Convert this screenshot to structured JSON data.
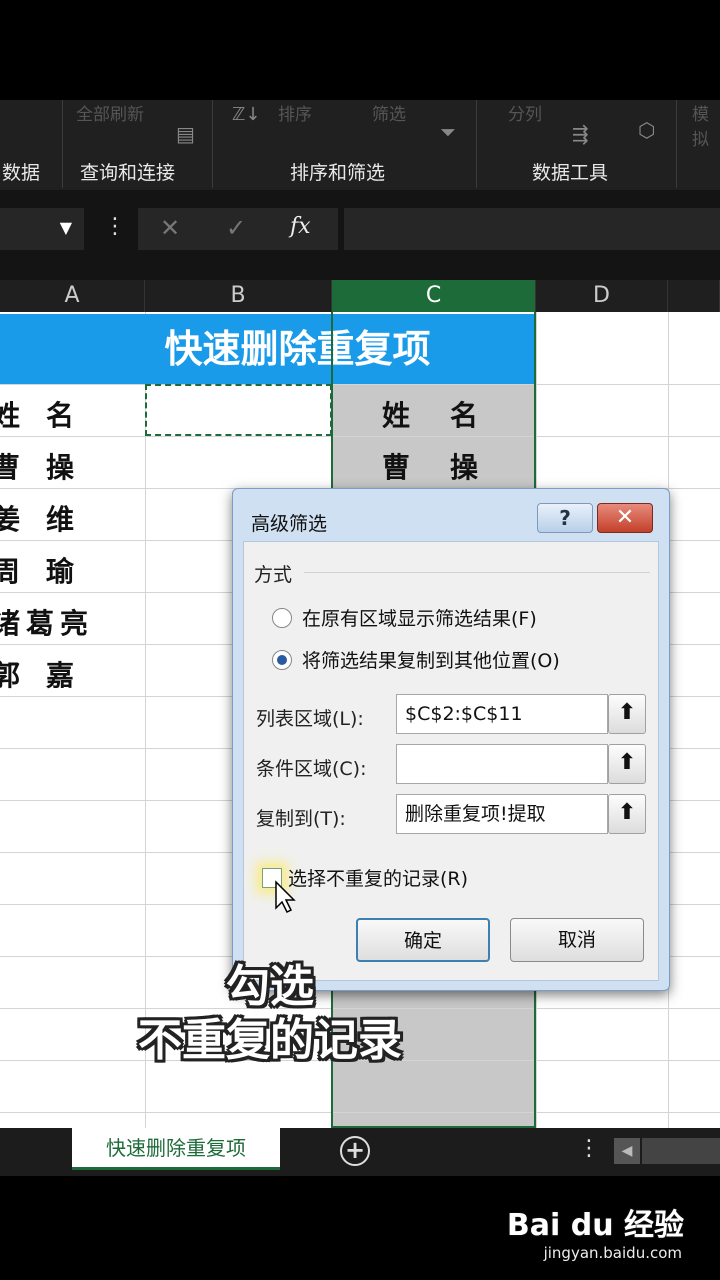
{
  "ribbon": {
    "top_items": [
      "全部刷新",
      "排序",
      "筛选",
      "分列",
      "模拟"
    ],
    "groups": [
      "数据",
      "查询和连接",
      "排序和筛选",
      "数据工具"
    ]
  },
  "formula_bar": {
    "fx_label": "fx",
    "cancel": "✕",
    "enter": "✓"
  },
  "columns": [
    "A",
    "B",
    "C",
    "D"
  ],
  "sheet": {
    "title": "快速删除重复项",
    "col_a": [
      "姓名",
      "曹操",
      "姜维",
      "周瑜",
      "诸葛亮",
      "郭嘉"
    ],
    "col_c": [
      "姓名",
      "曹操"
    ]
  },
  "dialog": {
    "title": "高级筛选",
    "help": "?",
    "close": "✕",
    "section": "方式",
    "radio1": "在原有区域显示筛选结果(F)",
    "radio2": "将筛选结果复制到其他位置(O)",
    "list_range_label": "列表区域(L):",
    "list_range_value": "$C$2:$C$11",
    "criteria_label": "条件区域(C):",
    "criteria_value": "",
    "copy_to_label": "复制到(T):",
    "copy_to_value": "删除重复项!提取",
    "unique_label": "选择不重复的记录(R)",
    "ok": "确定",
    "cancel": "取消",
    "ref_btn": "⬆"
  },
  "caption": {
    "line1": "勾选",
    "line2": "不重复的记录"
  },
  "tabs": {
    "active": "快速删除重复项",
    "add": "+"
  },
  "watermark": {
    "brand": "Bai du 经验",
    "url": "jingyan.baidu.com"
  }
}
